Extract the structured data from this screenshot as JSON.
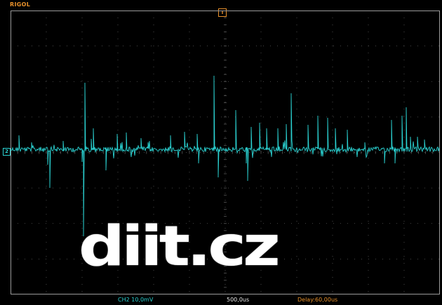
{
  "brand": "RIGOL",
  "trigger_marker": "T",
  "channel_marker": "2",
  "status": {
    "ch_scale": "CH2 10,0mV",
    "time_scale": "500,0us",
    "delay": "Delay:60,00us"
  },
  "watermark": "diit.cz",
  "colors": {
    "trace": "#2bd3d3",
    "accent": "#e8912b",
    "grid": "#5a5a5a",
    "background": "#000000"
  }
}
